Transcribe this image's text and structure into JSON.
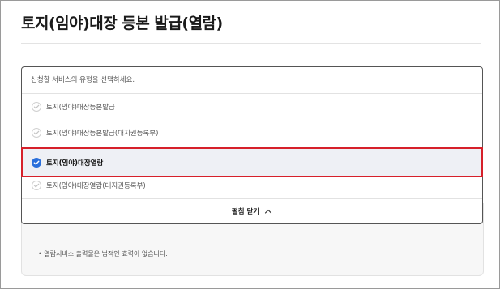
{
  "page": {
    "title": "토지(임야)대장 등본 발급(열람)"
  },
  "dropdown": {
    "prompt": "신청할 서비스의 유형을 선택하세요.",
    "options": [
      {
        "label": "토지(임야)대장등본발급",
        "selected": false
      },
      {
        "label": "토지(임야)대장등본발급(대지권등록부)",
        "selected": false
      },
      {
        "label": "토지(임야)대장열람",
        "selected": true
      },
      {
        "label": "토지(임야)대장열람(대지권등록부)",
        "selected": false
      }
    ],
    "collapse_label": "펼침 닫기",
    "icons": {
      "check": "check-circle-icon",
      "collapse": "chevron-up-icon"
    }
  },
  "info": {
    "note": "• 열람서비스 출력물은 법적인 효력이 없습니다."
  },
  "colors": {
    "accent": "#2a6fdb",
    "highlight_border": "#d6202a",
    "selected_bg": "#eef0f5"
  }
}
